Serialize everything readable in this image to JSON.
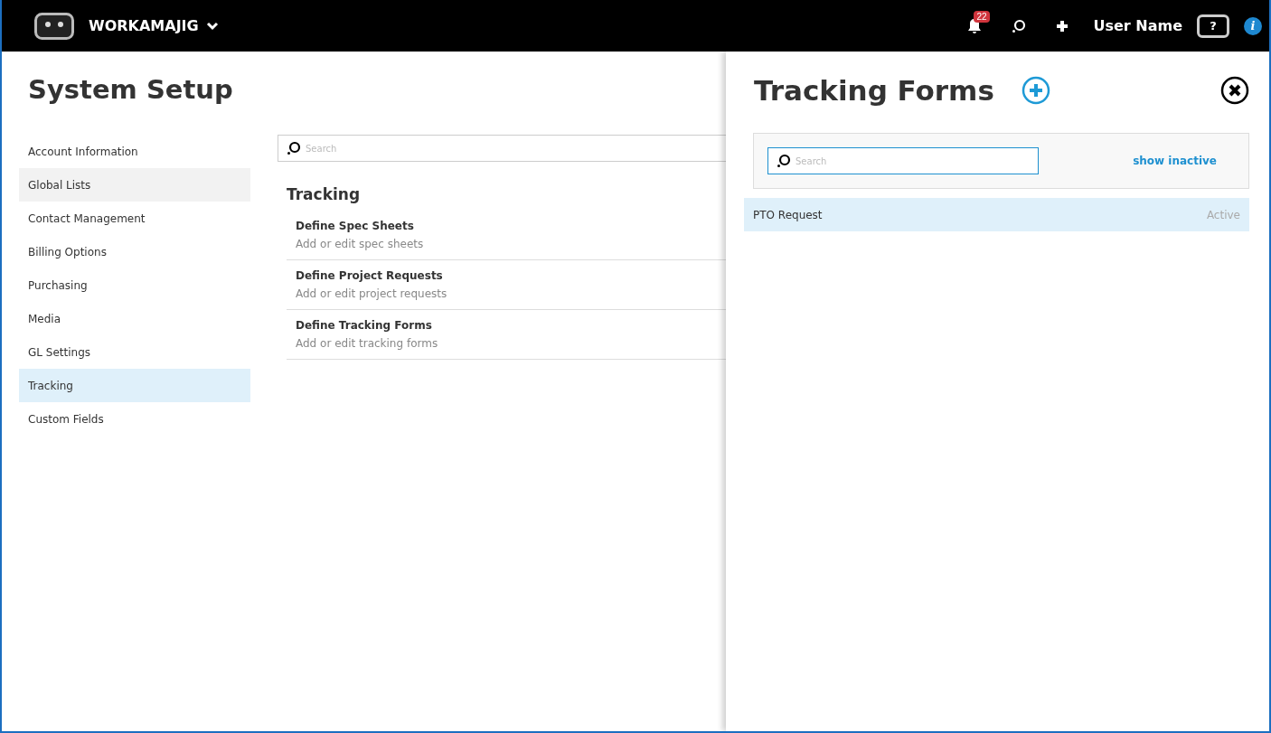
{
  "topbar": {
    "brand": "WORKAMAJIG",
    "notifications": "22",
    "user": "User Name",
    "help": "?",
    "info": "i"
  },
  "page": {
    "title": "System Setup"
  },
  "sidebar": {
    "items": [
      {
        "label": "Account Information",
        "selected": false,
        "hovered": false
      },
      {
        "label": "Global Lists",
        "selected": false,
        "hovered": true
      },
      {
        "label": "Contact Management",
        "selected": false,
        "hovered": false
      },
      {
        "label": "Billing Options",
        "selected": false,
        "hovered": false
      },
      {
        "label": "Purchasing",
        "selected": false,
        "hovered": false
      },
      {
        "label": "Media",
        "selected": false,
        "hovered": false
      },
      {
        "label": "GL Settings",
        "selected": false,
        "hovered": false
      },
      {
        "label": "Tracking",
        "selected": true,
        "hovered": false
      },
      {
        "label": "Custom Fields",
        "selected": false,
        "hovered": false
      }
    ]
  },
  "main": {
    "search": {
      "placeholder": "Search"
    },
    "section_title": "Tracking",
    "items": [
      {
        "title": "Define Spec Sheets",
        "description": "Add or edit spec sheets"
      },
      {
        "title": "Define Project Requests",
        "description": "Add or edit project requests"
      },
      {
        "title": "Define Tracking Forms",
        "description": "Add or edit tracking forms"
      }
    ]
  },
  "panel": {
    "title": "Tracking Forms",
    "search": {
      "placeholder": "Search"
    },
    "show_inactive": "show inactive",
    "rows": [
      {
        "name": "PTO Request",
        "status": "Active",
        "selected": true
      }
    ]
  }
}
